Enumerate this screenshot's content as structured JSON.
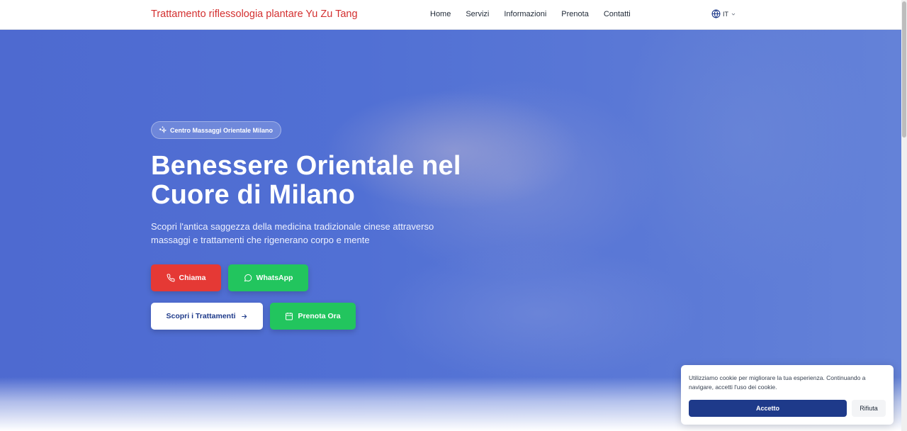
{
  "header": {
    "brand": "Trattamento riflessologia plantare Yu Zu Tang",
    "nav": [
      "Home",
      "Servizi",
      "Informazioni",
      "Prenota",
      "Contatti"
    ],
    "language": "IT",
    "brand_color": "#d32f2f"
  },
  "hero": {
    "badge": "Centro Massaggi Orientale Milano",
    "title": "Benessere Orientale nel Cuore di Milano",
    "subtitle": "Scopri l'antica saggezza della medicina tradizionale cinese attraverso massaggi e trattamenti che rigenerano corpo e mente",
    "buttons": {
      "call": "Chiama",
      "whatsapp": "WhatsApp",
      "treatments": "Scopri i Trattamenti",
      "book": "Prenota Ora"
    },
    "icons": {
      "badge": "sparkles-icon",
      "call": "phone-icon",
      "whatsapp": "whatsapp-icon",
      "treatments": "arrow-right-icon",
      "book": "calendar-icon"
    }
  },
  "cookie": {
    "text": "Utilizziamo cookie per migliorare la tua esperienza. Continuando a navigare, accetti l'uso dei cookie.",
    "accept": "Accetto",
    "reject": "Rifiuta"
  },
  "colors": {
    "primary": "#1e3a8a",
    "red": "#e53935",
    "green": "#22c55e",
    "hero_blue": "#5170d4"
  }
}
